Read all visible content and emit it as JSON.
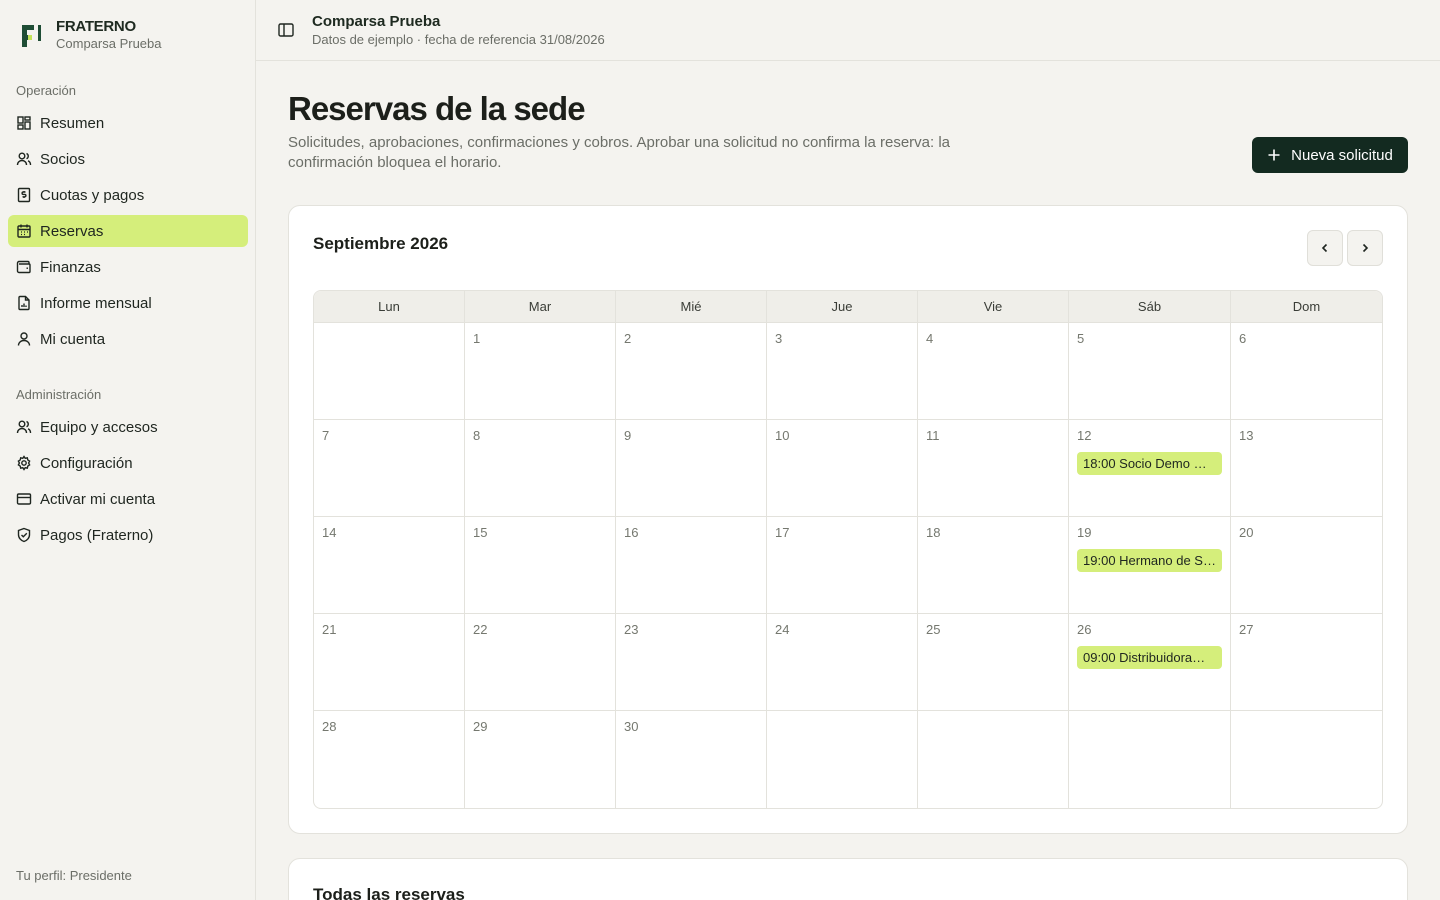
{
  "brand": {
    "name": "FRATERNO",
    "org": "Comparsa Prueba"
  },
  "sidebar": {
    "sections": [
      {
        "heading": "Operación",
        "items": [
          {
            "label": "Resumen",
            "icon": "dashboard-icon"
          },
          {
            "label": "Socios",
            "icon": "users-icon"
          },
          {
            "label": "Cuotas y pagos",
            "icon": "receipt-icon"
          },
          {
            "label": "Reservas",
            "icon": "calendar-icon",
            "active": true
          },
          {
            "label": "Finanzas",
            "icon": "wallet-icon"
          },
          {
            "label": "Informe mensual",
            "icon": "file-chart-icon"
          },
          {
            "label": "Mi cuenta",
            "icon": "user-icon"
          }
        ]
      },
      {
        "heading": "Administración",
        "items": [
          {
            "label": "Equipo y accesos",
            "icon": "team-icon"
          },
          {
            "label": "Configuración",
            "icon": "gear-icon"
          },
          {
            "label": "Activar mi cuenta",
            "icon": "credit-card-icon"
          },
          {
            "label": "Pagos (Fraterno)",
            "icon": "shield-check-icon"
          }
        ]
      }
    ],
    "footer": "Tu perfil: Presidente"
  },
  "topbar": {
    "title": "Comparsa Prueba",
    "subtitle": "Datos de ejemplo · fecha de referencia 31/08/2026"
  },
  "page": {
    "title": "Reservas de la sede",
    "description": "Solicitudes, aprobaciones, confirmaciones y cobros. Aprobar una solicitud no confirma la reserva: la confirmación bloquea el horario.",
    "new_button": "Nueva solicitud"
  },
  "calendar": {
    "month": "Septiembre 2026",
    "weekdays": [
      "Lun",
      "Mar",
      "Mié",
      "Jue",
      "Vie",
      "Sáb",
      "Dom"
    ],
    "weeks": [
      [
        null,
        "1",
        "2",
        "3",
        "4",
        "5",
        "6"
      ],
      [
        "7",
        "8",
        "9",
        "10",
        "11",
        "12",
        "13"
      ],
      [
        "14",
        "15",
        "16",
        "17",
        "18",
        "19",
        "20"
      ],
      [
        "21",
        "22",
        "23",
        "24",
        "25",
        "26",
        "27"
      ],
      [
        "28",
        "29",
        "30",
        null,
        null,
        null,
        null
      ]
    ],
    "events": {
      "12": "18:00 Socio Demo …",
      "19": "19:00 Hermano de S…",
      "26": "09:00 Distribuidora…"
    }
  },
  "reservations_list": {
    "title": "Todas las reservas"
  },
  "colors": {
    "accent": "#d5ee7b",
    "primary": "#132a20",
    "background": "#f4f3ef"
  }
}
